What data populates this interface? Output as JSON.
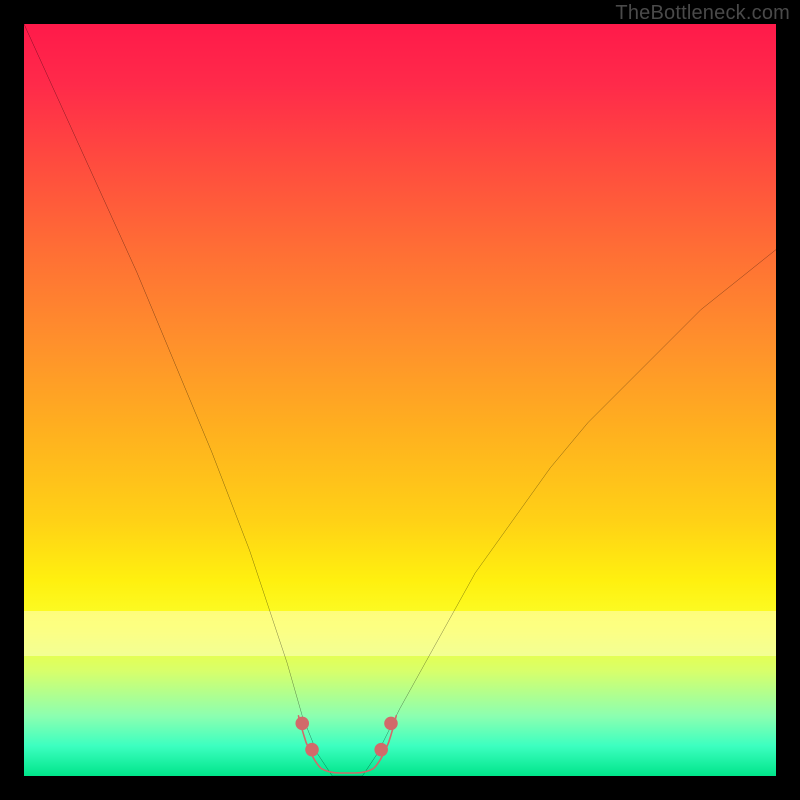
{
  "watermark": "TheBottleneck.com",
  "colors": {
    "frame": "#000000",
    "curve_stroke": "#000000",
    "bottom_marker": "#d16a6a",
    "gradient_top": "#ff1a4a",
    "gradient_bottom": "#00e58a"
  },
  "chart_data": {
    "type": "line",
    "title": "",
    "xlabel": "",
    "ylabel": "",
    "xlim": [
      0,
      100
    ],
    "ylim": [
      0,
      100
    ],
    "legend": false,
    "grid": false,
    "series": [
      {
        "name": "bottleneck-curve",
        "x": [
          0,
          5,
          10,
          15,
          20,
          25,
          30,
          35,
          37,
          39,
          41,
          43,
          45,
          47,
          50,
          55,
          60,
          65,
          70,
          75,
          80,
          85,
          90,
          95,
          100
        ],
        "values": [
          100,
          89,
          78,
          67,
          55,
          43,
          30,
          15,
          8,
          3,
          0,
          0,
          0,
          3,
          9,
          18,
          27,
          34,
          41,
          47,
          52,
          57,
          62,
          66,
          70
        ]
      }
    ],
    "annotations": [
      {
        "name": "optimal-flat-region",
        "x_start": 39,
        "x_end": 45,
        "y": 0
      }
    ],
    "background_gradient": {
      "direction": "vertical",
      "stops": [
        {
          "pos": 0.0,
          "meaning": "severe bottleneck",
          "color": "#ff1a4a"
        },
        {
          "pos": 0.5,
          "meaning": "moderate",
          "color": "#ffb01f"
        },
        {
          "pos": 0.8,
          "meaning": "mild",
          "color": "#fbff2a"
        },
        {
          "pos": 1.0,
          "meaning": "no bottleneck",
          "color": "#00e58a"
        }
      ]
    },
    "pale_band_y_range": [
      78,
      84
    ]
  }
}
